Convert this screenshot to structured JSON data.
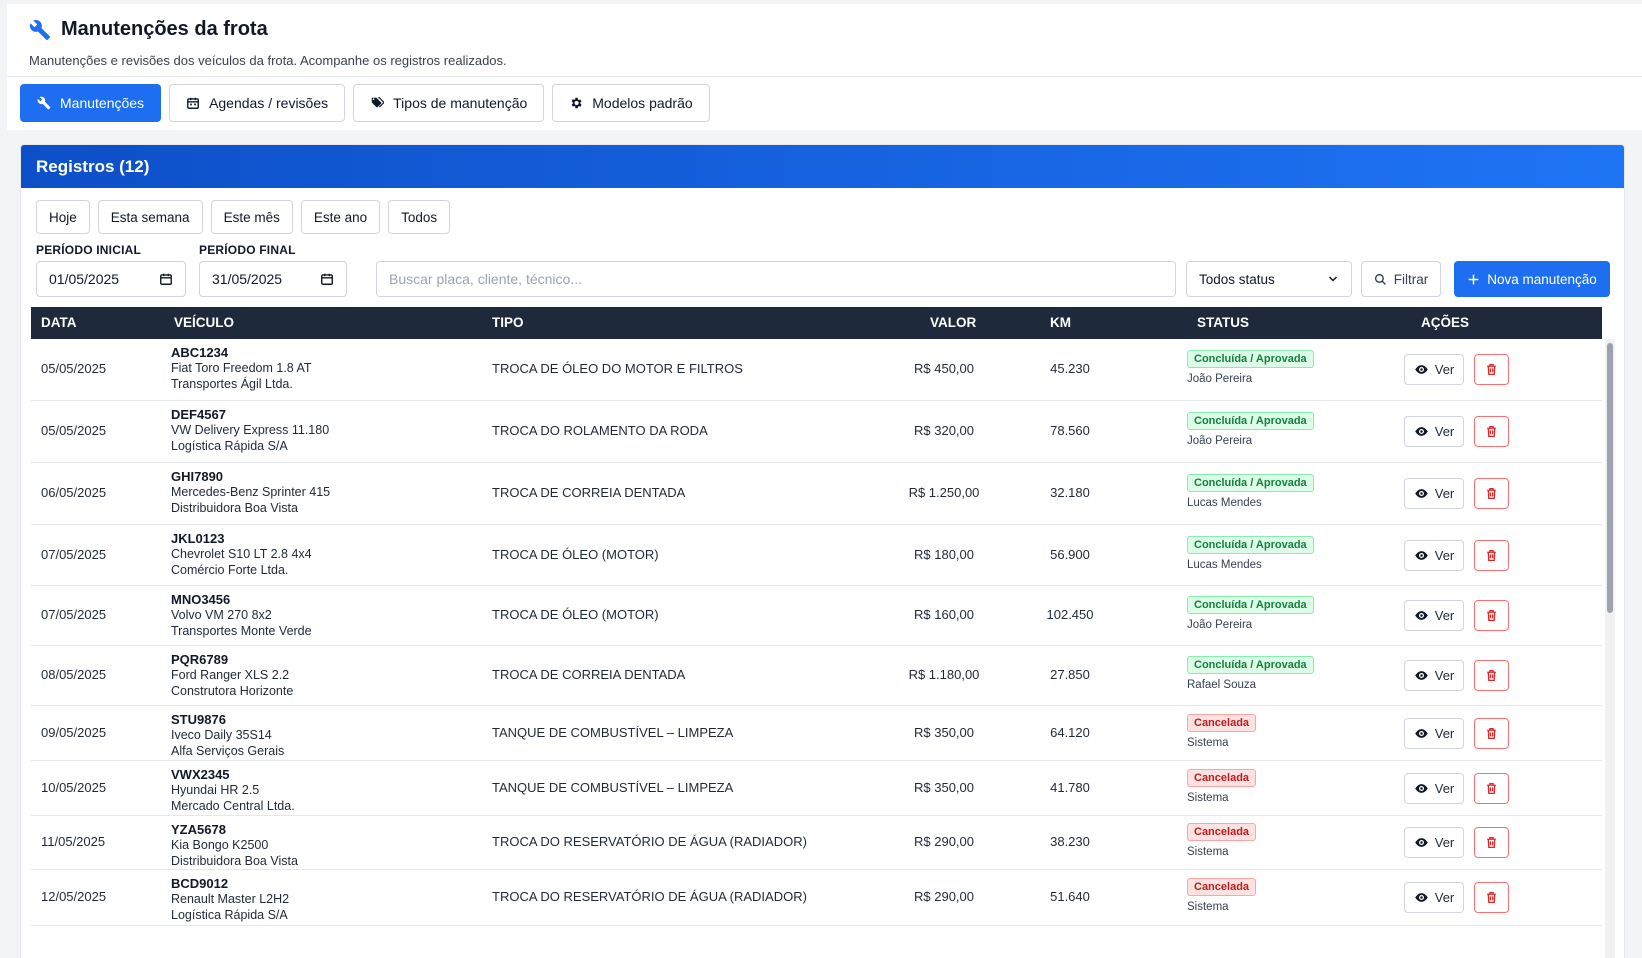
{
  "header": {
    "title": "Manutenções da frota",
    "subtitle": "Manutenções e revisões dos veículos da frota. Acompanhe os registros realizados."
  },
  "tabs": [
    {
      "label": "Manutenções",
      "icon": "wrench-icon",
      "active": true
    },
    {
      "label": "Agendas / revisões",
      "icon": "calendar-icon",
      "active": false
    },
    {
      "label": "Tipos de manutenção",
      "icon": "tags-icon",
      "active": false
    },
    {
      "label": "Modelos padrão",
      "icon": "gear-icon",
      "active": false
    }
  ],
  "panel": {
    "title": "Registros (12)",
    "period_chips": [
      "Hoje",
      "Esta semana",
      "Este mês",
      "Este ano",
      "Todos"
    ],
    "start_label": "PERÍODO INICIAL",
    "start_value": "01/05/2025",
    "end_label": "PERÍODO FINAL",
    "end_value": "31/05/2025",
    "search_placeholder": "Buscar placa, cliente, técnico...",
    "status_select": "Todos status",
    "filter_label": "Filtrar",
    "new_label": "Nova manutenção"
  },
  "table": {
    "headers": {
      "date": "DATA",
      "vehicle": "VEÍCULO",
      "type": "TIPO",
      "value": "VALOR",
      "km": "KM",
      "status": "STATUS",
      "actions": "AÇÕES"
    },
    "view_label": "Ver",
    "rows": [
      {
        "date": "05/05/2025",
        "plate": "ABC1234",
        "model": "Fiat Toro Freedom 1.8 AT",
        "client": "Transportes Ágil Ltda.",
        "type": "TROCA DE ÓLEO DO MOTOR E FILTROS",
        "value": "R$ 450,00",
        "km": "45.230",
        "status": "Concluída / Aprovada",
        "status_kind": "ok",
        "tech": "João Pereira"
      },
      {
        "date": "05/05/2025",
        "plate": "DEF4567",
        "model": "VW Delivery Express 11.180",
        "client": "Logística Rápida S/A",
        "type": "TROCA DO ROLAMENTO DA RODA",
        "value": "R$ 320,00",
        "km": "78.560",
        "status": "Concluída / Aprovada",
        "status_kind": "ok",
        "tech": "João Pereira"
      },
      {
        "date": "06/05/2025",
        "plate": "GHI7890",
        "model": "Mercedes-Benz Sprinter 415",
        "client": "Distribuidora Boa Vista",
        "type": "TROCA DE CORREIA DENTADA",
        "value": "R$ 1.250,00",
        "km": "32.180",
        "status": "Concluída / Aprovada",
        "status_kind": "ok",
        "tech": "Lucas Mendes"
      },
      {
        "date": "07/05/2025",
        "plate": "JKL0123",
        "model": "Chevrolet S10 LT 2.8 4x4",
        "client": "Comércio Forte Ltda.",
        "type": "TROCA DE ÓLEO (MOTOR)",
        "value": "R$ 180,00",
        "km": "56.900",
        "status": "Concluída / Aprovada",
        "status_kind": "ok",
        "tech": "Lucas Mendes"
      },
      {
        "date": "07/05/2025",
        "plate": "MNO3456",
        "model": "Volvo VM 270 8x2",
        "client": "Transportes Monte Verde",
        "type": "TROCA DE ÓLEO (MOTOR)",
        "value": "R$ 160,00",
        "km": "102.450",
        "status": "Concluída / Aprovada",
        "status_kind": "ok",
        "tech": "João Pereira"
      },
      {
        "date": "08/05/2025",
        "plate": "PQR6789",
        "model": "Ford Ranger XLS 2.2",
        "client": "Construtora Horizonte",
        "type": "TROCA DE CORREIA DENTADA",
        "value": "R$ 1.180,00",
        "km": "27.850",
        "status": "Concluída / Aprovada",
        "status_kind": "ok",
        "tech": "Rafael Souza"
      },
      {
        "date": "09/05/2025",
        "plate": "STU9876",
        "model": "Iveco Daily 35S14",
        "client": "Alfa Serviços Gerais",
        "type": "TANQUE DE COMBUSTÍVEL – LIMPEZA",
        "value": "R$ 350,00",
        "km": "64.120",
        "status": "Cancelada",
        "status_kind": "cancel",
        "tech": "Sistema"
      },
      {
        "date": "10/05/2025",
        "plate": "VWX2345",
        "model": "Hyundai HR 2.5",
        "client": "Mercado Central Ltda.",
        "type": "TANQUE DE COMBUSTÍVEL – LIMPEZA",
        "value": "R$ 350,00",
        "km": "41.780",
        "status": "Cancelada",
        "status_kind": "cancel",
        "tech": "Sistema"
      },
      {
        "date": "11/05/2025",
        "plate": "YZA5678",
        "model": "Kia Bongo K2500",
        "client": "Distribuidora Boa Vista",
        "type": "TROCA DO RESERVATÓRIO DE ÁGUA (RADIADOR)",
        "value": "R$ 290,00",
        "km": "38.230",
        "status": "Cancelada",
        "status_kind": "cancel",
        "tech": "Sistema"
      },
      {
        "date": "12/05/2025",
        "plate": "BCD9012",
        "model": "Renault Master L2H2",
        "client": "Logística Rápida S/A",
        "type": "TROCA DO RESERVATÓRIO DE ÁGUA (RADIADOR)",
        "value": "R$ 290,00",
        "km": "51.640",
        "status": "Cancelada",
        "status_kind": "cancel",
        "tech": "Sistema"
      }
    ]
  },
  "colors": {
    "primary": "#1d6ef0",
    "header_dark": "#1e293b",
    "ok": "#15803d",
    "cancel": "#b91c1c"
  }
}
